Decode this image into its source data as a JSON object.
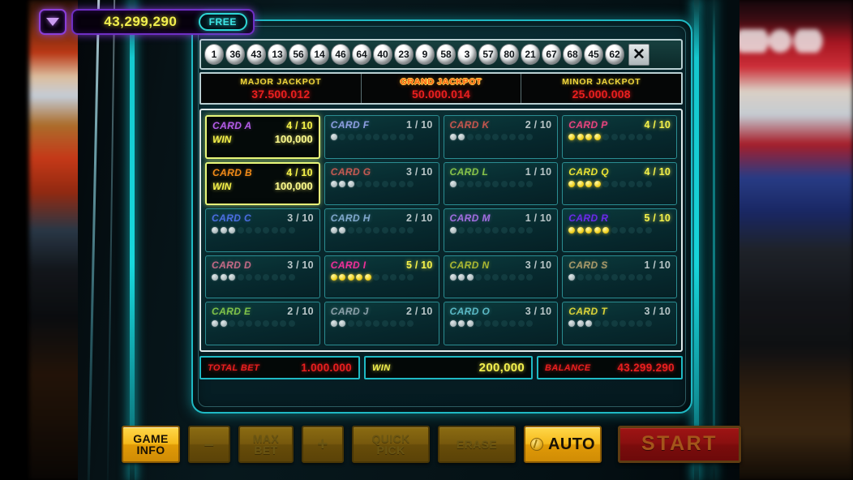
{
  "topbar": {
    "chevron_icon": "chevron-down-icon",
    "balance": "43,299,290",
    "free_label": "FREE"
  },
  "balls": {
    "numbers": [
      "1",
      "36",
      "43",
      "13",
      "56",
      "14",
      "46",
      "64",
      "40",
      "23",
      "9",
      "58",
      "3",
      "57",
      "80",
      "21",
      "67",
      "68",
      "45",
      "62"
    ],
    "close_label": "✕"
  },
  "jackpots": [
    {
      "name": "MAJOR JACKPOT",
      "value": "37.500.012",
      "name_color": "#f0d63c",
      "value_color": "#ea1f1f"
    },
    {
      "name": "GRAND JACKPOT",
      "value": "50.000.014",
      "name_color": "#ff5a12",
      "value_color": "#ea1f1f"
    },
    {
      "name": "MINOR JACKPOT",
      "value": "25.000.008",
      "name_color": "#f0d63c",
      "value_color": "#ea1f1f"
    }
  ],
  "cards": [
    {
      "name": "CARD A",
      "count": "4 / 10",
      "marked": 4,
      "total": 10,
      "color": "#b45ce8",
      "state": "win",
      "win_label": "WIN",
      "win_value": "100,000"
    },
    {
      "name": "CARD F",
      "count": "1 / 10",
      "marked": 1,
      "total": 10,
      "color": "#8c9ee0",
      "state": "normal"
    },
    {
      "name": "CARD K",
      "count": "2 / 10",
      "marked": 2,
      "total": 10,
      "color": "#c4564e",
      "state": "normal"
    },
    {
      "name": "CARD P",
      "count": "4 / 10",
      "marked": 4,
      "total": 10,
      "color": "#e8447e",
      "state": "hot"
    },
    {
      "name": "CARD B",
      "count": "4 / 10",
      "marked": 4,
      "total": 10,
      "color": "#f08a18",
      "state": "win",
      "win_label": "WIN",
      "win_value": "100,000"
    },
    {
      "name": "CARD G",
      "count": "3 / 10",
      "marked": 3,
      "total": 10,
      "color": "#c25a52",
      "state": "normal"
    },
    {
      "name": "CARD L",
      "count": "1 / 10",
      "marked": 1,
      "total": 10,
      "color": "#86c24a",
      "state": "normal"
    },
    {
      "name": "CARD Q",
      "count": "4 / 10",
      "marked": 4,
      "total": 10,
      "color": "#e8e234",
      "state": "hot"
    },
    {
      "name": "CARD C",
      "count": "3 / 10",
      "marked": 3,
      "total": 10,
      "color": "#4a6ee0",
      "state": "normal"
    },
    {
      "name": "CARD H",
      "count": "2 / 10",
      "marked": 2,
      "total": 10,
      "color": "#7fa8cc",
      "state": "normal"
    },
    {
      "name": "CARD M",
      "count": "1 / 10",
      "marked": 1,
      "total": 10,
      "color": "#a06ee0",
      "state": "normal"
    },
    {
      "name": "CARD R",
      "count": "5 / 10",
      "marked": 5,
      "total": 10,
      "color": "#6a2ae8",
      "state": "hot"
    },
    {
      "name": "CARD D",
      "count": "3 / 10",
      "marked": 3,
      "total": 10,
      "color": "#c26a86",
      "state": "normal"
    },
    {
      "name": "CARD I",
      "count": "5 / 10",
      "marked": 5,
      "total": 10,
      "color": "#f0309a",
      "state": "hot"
    },
    {
      "name": "CARD N",
      "count": "3 / 10",
      "marked": 3,
      "total": 10,
      "color": "#aab832",
      "state": "normal"
    },
    {
      "name": "CARD S",
      "count": "1 / 10",
      "marked": 1,
      "total": 10,
      "color": "#a89a6a",
      "state": "normal"
    },
    {
      "name": "CARD E",
      "count": "2 / 10",
      "marked": 2,
      "total": 10,
      "color": "#7ec24a",
      "state": "normal"
    },
    {
      "name": "CARD J",
      "count": "2 / 10",
      "marked": 2,
      "total": 10,
      "color": "#8aa0a8",
      "state": "normal"
    },
    {
      "name": "CARD O",
      "count": "3 / 10",
      "marked": 3,
      "total": 10,
      "color": "#5ab8c4",
      "state": "normal"
    },
    {
      "name": "CARD T",
      "count": "3 / 10",
      "marked": 3,
      "total": 10,
      "color": "#d8d23a",
      "state": "normal"
    }
  ],
  "totals": {
    "bet_label": "TOTAL BET",
    "bet_value": "1.000.000",
    "win_label": "WIN",
    "win_value": "200,000",
    "balance_label": "BALANCE",
    "balance_value": "43.299.290"
  },
  "buttons": {
    "game_info": "GAME\nINFO",
    "game_info_line1": "GAME",
    "game_info_line2": "INFO",
    "minus": "–",
    "max_bet_line1": "MAX",
    "max_bet_line2": "BET",
    "plus": "+",
    "quick_pick_line1": "QUICK",
    "quick_pick_line2": "PICK",
    "erase": "ERASE",
    "auto": "AUTO",
    "auto_icon": "coin-icon",
    "start": "START"
  },
  "colors": {
    "neon_teal": "#1fb9c4",
    "gold": "#f5b91b",
    "start_red": "#8a1010",
    "purple": "#6f2fc4",
    "jackpot_red": "#ea1f1f",
    "yellow": "#f2ef4e"
  }
}
